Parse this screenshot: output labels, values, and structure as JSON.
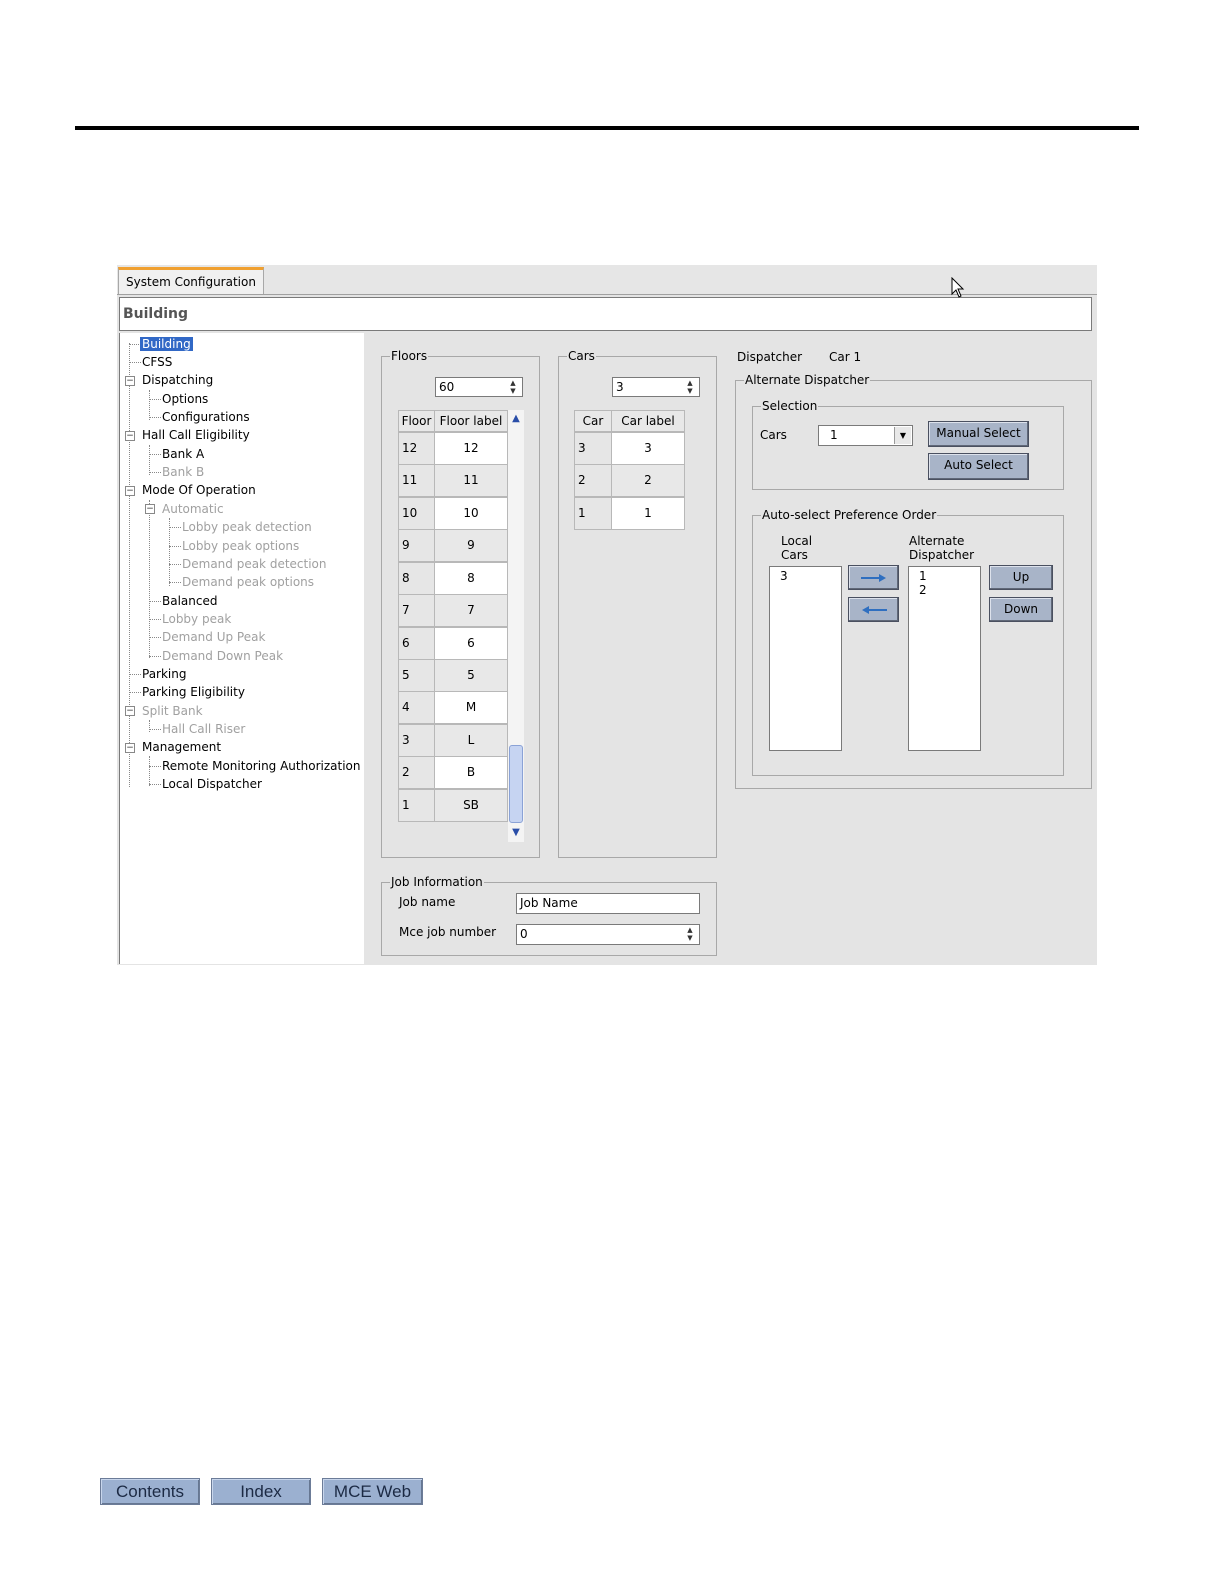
{
  "window": {
    "tab_label": "System Configuration",
    "section_title": "Building"
  },
  "tree": {
    "items": [
      {
        "label": "Building"
      },
      {
        "label": "CFSS"
      },
      {
        "label": "Dispatching"
      },
      {
        "label": "Options"
      },
      {
        "label": "Configurations"
      },
      {
        "label": "Hall Call Eligibility"
      },
      {
        "label": "Bank A"
      },
      {
        "label": "Bank B"
      },
      {
        "label": "Mode Of Operation"
      },
      {
        "label": "Automatic"
      },
      {
        "label": "Lobby peak detection"
      },
      {
        "label": "Lobby peak options"
      },
      {
        "label": "Demand peak detection"
      },
      {
        "label": "Demand peak options"
      },
      {
        "label": "Balanced"
      },
      {
        "label": "Lobby peak"
      },
      {
        "label": "Demand Up Peak"
      },
      {
        "label": "Demand Down Peak"
      },
      {
        "label": "Parking"
      },
      {
        "label": "Parking Eligibility"
      },
      {
        "label": "Split Bank"
      },
      {
        "label": "Hall Call Riser"
      },
      {
        "label": "Management"
      },
      {
        "label": "Remote Monitoring Authorization"
      },
      {
        "label": "Local Dispatcher"
      }
    ]
  },
  "floors": {
    "group_title": "Floors",
    "count_value": "60",
    "col_floor": "Floor",
    "col_label": "Floor label",
    "rows": [
      {
        "floor": "12",
        "label": "12"
      },
      {
        "floor": "11",
        "label": "11"
      },
      {
        "floor": "10",
        "label": "10"
      },
      {
        "floor": "9",
        "label": "9"
      },
      {
        "floor": "8",
        "label": "8"
      },
      {
        "floor": "7",
        "label": "7"
      },
      {
        "floor": "6",
        "label": "6"
      },
      {
        "floor": "5",
        "label": "5"
      },
      {
        "floor": "4",
        "label": "M"
      },
      {
        "floor": "3",
        "label": "L"
      },
      {
        "floor": "2",
        "label": "B"
      },
      {
        "floor": "1",
        "label": "SB"
      }
    ]
  },
  "cars": {
    "group_title": "Cars",
    "count_value": "3",
    "col_car": "Car",
    "col_label": "Car label",
    "rows": [
      {
        "car": "3",
        "label": "3"
      },
      {
        "car": "2",
        "label": "2"
      },
      {
        "car": "1",
        "label": "1"
      }
    ]
  },
  "dispatcher": {
    "label": "Dispatcher",
    "value": "Car 1"
  },
  "alternate": {
    "group_title": "Alternate Dispatcher",
    "selection_title": "Selection",
    "cars_label": "Cars",
    "cars_selected": "1",
    "manual_select": "Manual Select",
    "auto_select": "Auto Select",
    "pref_title": "Auto-select Preference Order",
    "local_cars_line1": "Local",
    "local_cars_line2": "Cars",
    "alt_disp_line1": "Alternate",
    "alt_disp_line2": "Dispatcher",
    "local_list": [
      "3"
    ],
    "alt_list": [
      "1",
      "2"
    ],
    "up": "Up",
    "down": "Down"
  },
  "job": {
    "group_title": "Job Information",
    "name_label": "Job name",
    "name_value": "Job Name",
    "number_label": "Mce job number",
    "number_value": "0"
  },
  "footer": {
    "contents": "Contents",
    "index": "Index",
    "mce_web": "MCE Web"
  }
}
